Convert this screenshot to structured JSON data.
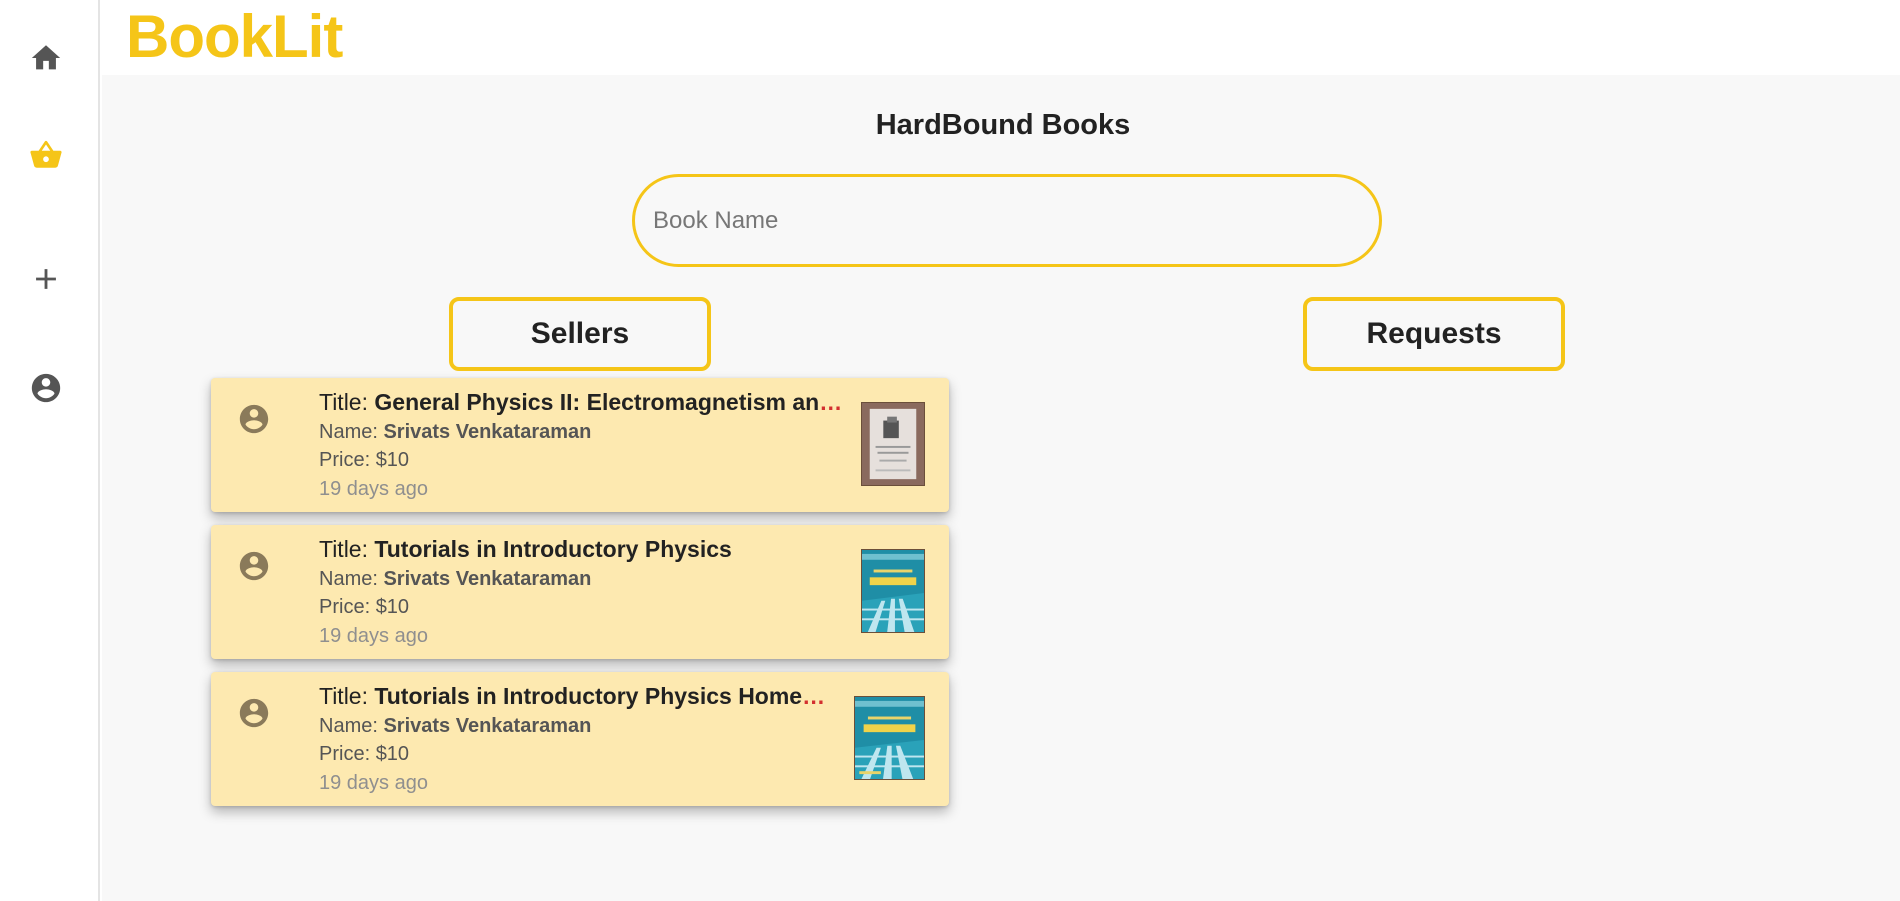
{
  "app": {
    "logo": "BookLit"
  },
  "sidebar": {
    "items": [
      {
        "icon": "home-icon",
        "active": false
      },
      {
        "icon": "basket-icon",
        "active": true
      },
      {
        "icon": "plus-icon",
        "active": false
      },
      {
        "icon": "account-circle-icon",
        "active": false
      }
    ]
  },
  "page": {
    "title": "HardBound Books"
  },
  "search": {
    "placeholder": "Book Name",
    "value": ""
  },
  "tabs": {
    "sellers": "Sellers",
    "requests": "Requests"
  },
  "labels": {
    "title": "Title: ",
    "name": "Name: ",
    "price": "Price: "
  },
  "listings": [
    {
      "title": "General Physics II: Electromagnetism an",
      "truncated": true,
      "name": "Srivats Venkataraman",
      "price": "$10",
      "posted": "19 days ago",
      "thumbnail": "book-photo"
    },
    {
      "title": "Tutorials in Introductory Physics",
      "truncated": false,
      "name": "Srivats Venkataraman",
      "price": "$10",
      "posted": "19 days ago",
      "thumbnail": "book-cover-physics"
    },
    {
      "title": "Tutorials in Introductory Physics Home",
      "truncated": true,
      "name": "Srivats Venkataraman",
      "price": "$10",
      "posted": "19 days ago",
      "thumbnail": "book-cover-physics"
    }
  ],
  "colors": {
    "accent": "#f5c518",
    "card_background": "#fde9b0",
    "page_background": "#f8f8f8",
    "truncation_ellipsis": "#d32f2f"
  }
}
